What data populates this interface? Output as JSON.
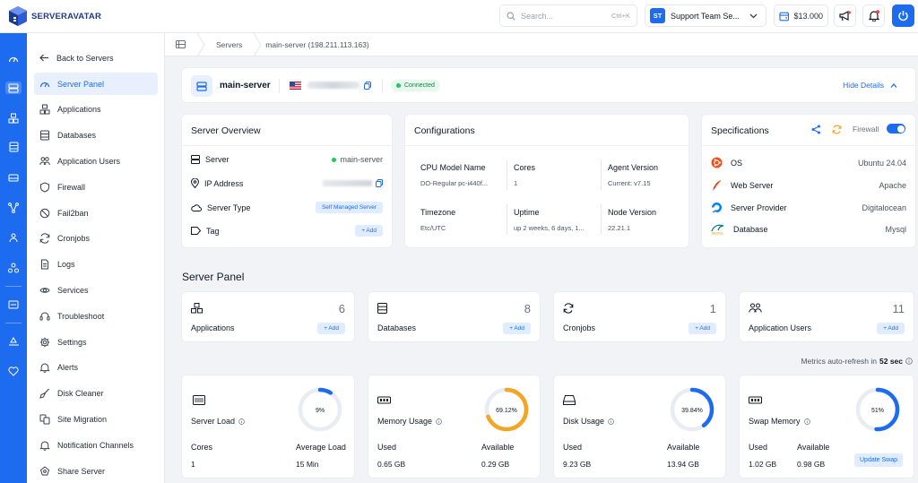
{
  "brand": {
    "name": "SERVERAVATAR"
  },
  "search": {
    "placeholder": "Search...",
    "shortcut": "Ctrl+K"
  },
  "team": {
    "initials": "ST",
    "name": "Support Team Se..."
  },
  "balance": "$13.000",
  "breadcrumb": [
    "Servers",
    "main-server (198.211.113.163)"
  ],
  "sidebar": {
    "back": "Back to Servers",
    "items": [
      {
        "label": "Server Panel",
        "icon": "dashboard-icon"
      },
      {
        "label": "Applications",
        "icon": "applications-icon"
      },
      {
        "label": "Databases",
        "icon": "database-icon"
      },
      {
        "label": "Application Users",
        "icon": "users-icon"
      },
      {
        "label": "Firewall",
        "icon": "shield-icon"
      },
      {
        "label": "Fail2ban",
        "icon": "ban-icon"
      },
      {
        "label": "Cronjobs",
        "icon": "sync-icon"
      },
      {
        "label": "Logs",
        "icon": "file-icon"
      },
      {
        "label": "Services",
        "icon": "services-icon"
      },
      {
        "label": "Troubleshoot",
        "icon": "headset-icon"
      },
      {
        "label": "Settings",
        "icon": "gear-icon"
      },
      {
        "label": "Alerts",
        "icon": "bell-icon"
      },
      {
        "label": "Disk Cleaner",
        "icon": "broom-icon"
      },
      {
        "label": "Site Migration",
        "icon": "migration-icon"
      },
      {
        "label": "Notification Channels",
        "icon": "bell-icon"
      },
      {
        "label": "Share Server",
        "icon": "share-icon"
      }
    ]
  },
  "server_header": {
    "name": "main-server",
    "status": "Connected",
    "toggle": "Hide Details"
  },
  "overview": {
    "title": "Server Overview",
    "rows": [
      {
        "label": "Server",
        "value": "main-server"
      },
      {
        "label": "IP Address",
        "value": ""
      },
      {
        "label": "Server Type",
        "value": "Self Managed Server"
      },
      {
        "label": "Tag",
        "value": "+ Add"
      }
    ]
  },
  "config": {
    "title": "Configurations",
    "items": [
      {
        "key": "CPU Model Name",
        "value": "DO-Regular pc-i440f..."
      },
      {
        "key": "Cores",
        "value": "1"
      },
      {
        "key": "Agent Version",
        "value": "Current: v7.15"
      },
      {
        "key": "Timezone",
        "value": "Etc/UTC"
      },
      {
        "key": "Uptime",
        "value": "up 2 weeks, 6 days, 1..."
      },
      {
        "key": "Node Version",
        "value": "22.21.1"
      }
    ]
  },
  "specs": {
    "title": "Specifications",
    "firewall_label": "Firewall",
    "firewall_on": true,
    "rows": [
      {
        "label": "OS",
        "value": "Ubuntu 24.04"
      },
      {
        "label": "Web Server",
        "value": "Apache"
      },
      {
        "label": "Server Provider",
        "value": "Digitalocean"
      },
      {
        "label": "Database",
        "value": "Mysql"
      }
    ]
  },
  "panel": {
    "title": "Server Panel",
    "add_label": "+ Add",
    "stats": [
      {
        "label": "Applications",
        "count": "6"
      },
      {
        "label": "Databases",
        "count": "8"
      },
      {
        "label": "Cronjobs",
        "count": "1"
      },
      {
        "label": "Application Users",
        "count": "11"
      }
    ]
  },
  "metrics": {
    "refresh_prefix": "Metrics auto-refresh in",
    "refresh_value": "52 sec",
    "cards": [
      {
        "title": "Server Load",
        "percent_label": "9%",
        "percent": 9,
        "color": "#1d6cf0",
        "k1": "Cores",
        "v1": "1",
        "k2": "Average Load",
        "v2": "15 Min"
      },
      {
        "title": "Memory Usage",
        "percent_label": "69.12%",
        "percent": 69.12,
        "color": "#f5a524",
        "k1": "Used",
        "v1": "0.65 GB",
        "k2": "Available",
        "v2": "0.29 GB"
      },
      {
        "title": "Disk Usage",
        "percent_label": "39.84%",
        "percent": 39.84,
        "color": "#1d6cf0",
        "k1": "Used",
        "v1": "9.23 GB",
        "k2": "Available",
        "v2": "13.94 GB"
      },
      {
        "title": "Swap Memory",
        "percent_label": "51%",
        "percent": 51,
        "color": "#1d6cf0",
        "k1": "Used",
        "v1": "1.02 GB",
        "k2": "Available",
        "v2": "0.98 GB",
        "button": "Update Swap"
      }
    ]
  },
  "colors": {
    "accent": "#1d6cf0",
    "success": "#22c55e",
    "warning": "#f5a524"
  }
}
